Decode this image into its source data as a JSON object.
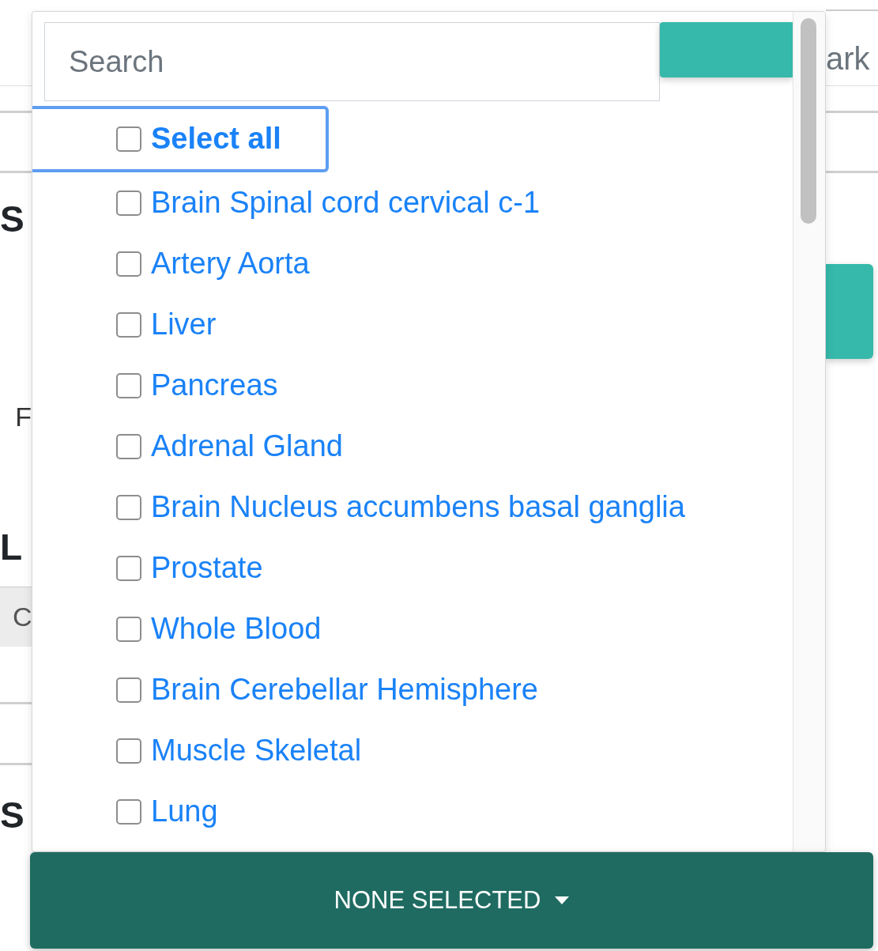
{
  "background": {
    "left": [
      {
        "kind": "heading",
        "text": "S"
      },
      {
        "kind": "text",
        "text": "F"
      },
      {
        "kind": "heading",
        "text": "L"
      },
      {
        "kind": "box",
        "text": "C"
      },
      {
        "kind": "heading",
        "text": "S"
      }
    ],
    "right": [
      {
        "text": "ark"
      }
    ]
  },
  "dropdown": {
    "search": {
      "placeholder": "Search"
    },
    "items": [
      {
        "kind": "select_all",
        "label": "Select all",
        "checked": false,
        "focused": true
      },
      {
        "kind": "option",
        "label": "Brain Spinal cord cervical c-1",
        "checked": false,
        "focused": false
      },
      {
        "kind": "option",
        "label": "Artery Aorta",
        "checked": false,
        "focused": false
      },
      {
        "kind": "option",
        "label": "Liver",
        "checked": false,
        "focused": false
      },
      {
        "kind": "option",
        "label": "Pancreas",
        "checked": false,
        "focused": false
      },
      {
        "kind": "option",
        "label": "Adrenal Gland",
        "checked": false,
        "focused": false
      },
      {
        "kind": "option",
        "label": "Brain Nucleus accumbens basal ganglia",
        "checked": false,
        "focused": false
      },
      {
        "kind": "option",
        "label": "Prostate",
        "checked": false,
        "focused": false
      },
      {
        "kind": "option",
        "label": "Whole Blood",
        "checked": false,
        "focused": false
      },
      {
        "kind": "option",
        "label": "Brain Cerebellar Hemisphere",
        "checked": false,
        "focused": false
      },
      {
        "kind": "option",
        "label": "Muscle Skeletal",
        "checked": false,
        "focused": false
      },
      {
        "kind": "option",
        "label": "Lung",
        "checked": false,
        "focused": false
      }
    ]
  },
  "toggle_button": {
    "label": "NONE SELECTED"
  }
}
